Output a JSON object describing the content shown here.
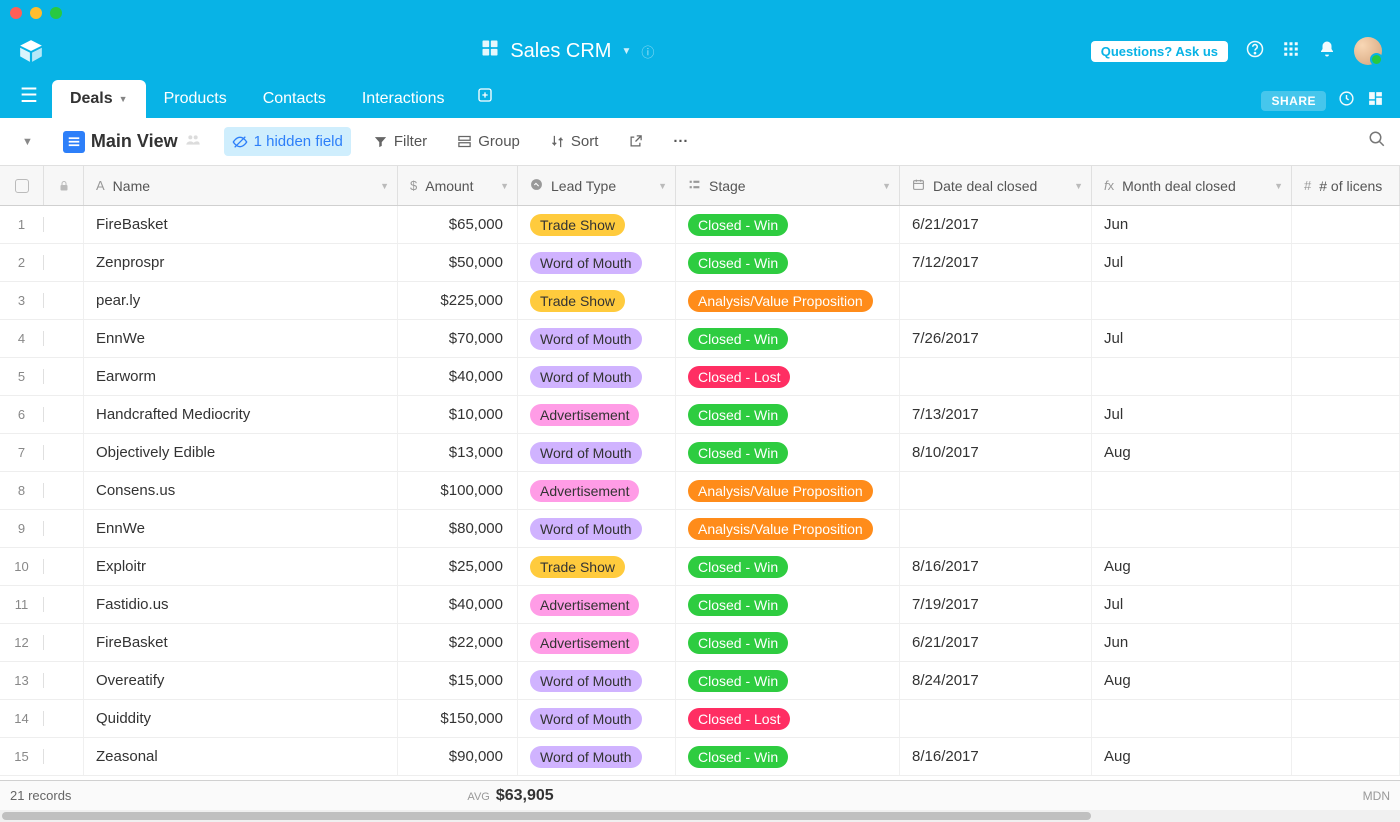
{
  "app": {
    "title": "Sales CRM"
  },
  "header": {
    "ask_button": "Questions? Ask us"
  },
  "tabbar": {
    "tabs": [
      "Deals",
      "Products",
      "Contacts",
      "Interactions"
    ],
    "active_index": 0,
    "share_label": "SHARE"
  },
  "toolbar": {
    "main_view": "Main View",
    "hidden_field": "1 hidden field",
    "filter": "Filter",
    "group": "Group",
    "sort": "Sort"
  },
  "columns": {
    "name": "Name",
    "amount": "Amount",
    "lead": "Lead Type",
    "stage": "Stage",
    "date": "Date deal closed",
    "month": "Month deal closed",
    "lic": "# of licens"
  },
  "lead_colors": {
    "Trade Show": "lead-trade",
    "Word of Mouth": "lead-word",
    "Advertisement": "lead-ad"
  },
  "stage_colors": {
    "Closed - Win": "stage-win",
    "Analysis/Value Proposition": "stage-analysis",
    "Closed - Lost": "stage-lost"
  },
  "rows": [
    {
      "name": "FireBasket",
      "amount": "$65,000",
      "lead": "Trade Show",
      "stage": "Closed - Win",
      "date": "6/21/2017",
      "month": "Jun"
    },
    {
      "name": "Zenprospr",
      "amount": "$50,000",
      "lead": "Word of Mouth",
      "stage": "Closed - Win",
      "date": "7/12/2017",
      "month": "Jul"
    },
    {
      "name": "pear.ly",
      "amount": "$225,000",
      "lead": "Trade Show",
      "stage": "Analysis/Value Proposition",
      "date": "",
      "month": ""
    },
    {
      "name": "EnnWe",
      "amount": "$70,000",
      "lead": "Word of Mouth",
      "stage": "Closed - Win",
      "date": "7/26/2017",
      "month": "Jul"
    },
    {
      "name": "Earworm",
      "amount": "$40,000",
      "lead": "Word of Mouth",
      "stage": "Closed - Lost",
      "date": "",
      "month": ""
    },
    {
      "name": "Handcrafted Mediocrity",
      "amount": "$10,000",
      "lead": "Advertisement",
      "stage": "Closed - Win",
      "date": "7/13/2017",
      "month": "Jul"
    },
    {
      "name": "Objectively Edible",
      "amount": "$13,000",
      "lead": "Word of Mouth",
      "stage": "Closed - Win",
      "date": "8/10/2017",
      "month": "Aug"
    },
    {
      "name": "Consens.us",
      "amount": "$100,000",
      "lead": "Advertisement",
      "stage": "Analysis/Value Proposition",
      "date": "",
      "month": ""
    },
    {
      "name": "EnnWe",
      "amount": "$80,000",
      "lead": "Word of Mouth",
      "stage": "Analysis/Value Proposition",
      "date": "",
      "month": ""
    },
    {
      "name": "Exploitr",
      "amount": "$25,000",
      "lead": "Trade Show",
      "stage": "Closed - Win",
      "date": "8/16/2017",
      "month": "Aug"
    },
    {
      "name": "Fastidio.us",
      "amount": "$40,000",
      "lead": "Advertisement",
      "stage": "Closed - Win",
      "date": "7/19/2017",
      "month": "Jul"
    },
    {
      "name": "FireBasket",
      "amount": "$22,000",
      "lead": "Advertisement",
      "stage": "Closed - Win",
      "date": "6/21/2017",
      "month": "Jun"
    },
    {
      "name": "Overeatify",
      "amount": "$15,000",
      "lead": "Word of Mouth",
      "stage": "Closed - Win",
      "date": "8/24/2017",
      "month": "Aug"
    },
    {
      "name": "Quiddity",
      "amount": "$150,000",
      "lead": "Word of Mouth",
      "stage": "Closed - Lost",
      "date": "",
      "month": ""
    },
    {
      "name": "Zeasonal",
      "amount": "$90,000",
      "lead": "Word of Mouth",
      "stage": "Closed - Win",
      "date": "8/16/2017",
      "month": "Aug"
    }
  ],
  "footer": {
    "record_count": "21 records",
    "avg_label": "AVG",
    "avg_value": "$63,905",
    "mdn": "MDN"
  }
}
